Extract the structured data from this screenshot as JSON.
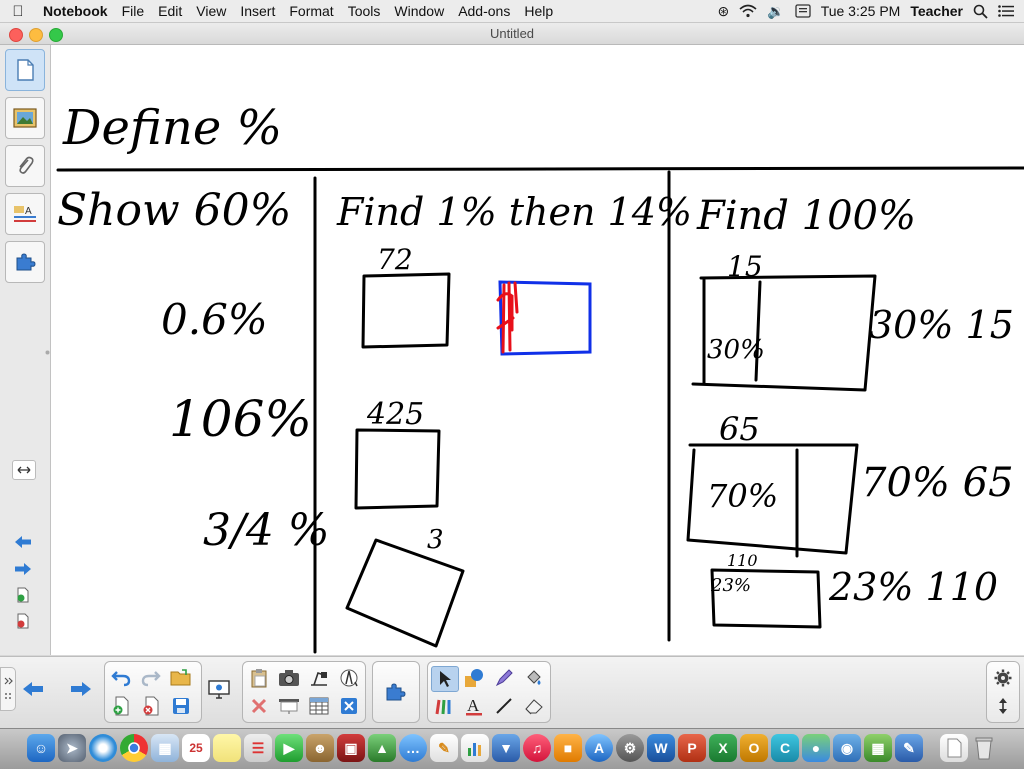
{
  "menubar": {
    "app_name": "Notebook",
    "items": [
      "File",
      "Edit",
      "View",
      "Insert",
      "Format",
      "Tools",
      "Window",
      "Add-ons",
      "Help"
    ],
    "clock": "Tue 3:25 PM",
    "user": "Teacher"
  },
  "window": {
    "title": "Untitled"
  },
  "board": {
    "heading": "Define %",
    "columns": [
      {
        "header": "Show 60%",
        "items": [
          "0.6%",
          "106%",
          "3/4 %"
        ]
      },
      {
        "header": "Find 1% then 14%",
        "items": [
          "72",
          "425",
          "3"
        ]
      },
      {
        "header": "Find 100%",
        "items": [
          "15",
          "30%",
          "30% 15",
          "65",
          "70%",
          "70% 65",
          "110",
          "23%",
          "23% 110"
        ]
      }
    ]
  },
  "colors": {
    "ink": "#000000",
    "red_ink": "#e8101a",
    "blue_ink": "#1030e8",
    "select_highlight": "#b8d2ee"
  }
}
